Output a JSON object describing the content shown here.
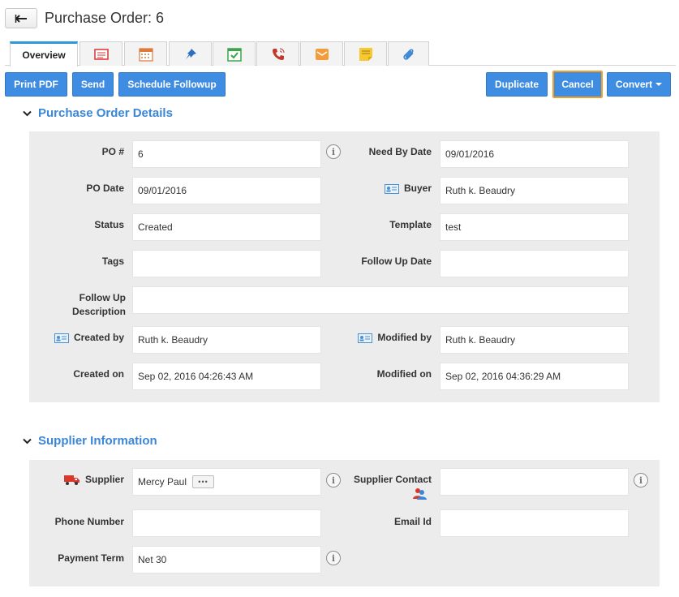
{
  "header": {
    "title": "Purchase Order: 6",
    "back_icon": "back-arrow-icon"
  },
  "tabs": {
    "overview_label": "Overview",
    "icons": [
      "notes-icon",
      "calendar-icon",
      "pin-icon",
      "task-icon",
      "call-icon",
      "email-icon",
      "sticky-note-icon",
      "attachment-icon"
    ]
  },
  "toolbar": {
    "print_pdf": "Print PDF",
    "send": "Send",
    "schedule_followup": "Schedule Followup",
    "duplicate": "Duplicate",
    "cancel": "Cancel",
    "convert": "Convert"
  },
  "po_details": {
    "title": "Purchase Order Details",
    "po_num_label": "PO #",
    "po_num_value": "6",
    "need_by_label": "Need By Date",
    "need_by_value": "09/01/2016",
    "po_date_label": "PO Date",
    "po_date_value": "09/01/2016",
    "buyer_label": "Buyer",
    "buyer_value": "Ruth k. Beaudry",
    "status_label": "Status",
    "status_value": "Created",
    "template_label": "Template",
    "template_value": "test",
    "tags_label": "Tags",
    "tags_value": "",
    "follow_up_date_label": "Follow Up Date",
    "follow_up_date_value": "",
    "follow_up_desc_label_1": "Follow Up",
    "follow_up_desc_label_2": "Description",
    "follow_up_desc_value": "",
    "created_by_label": "Created by",
    "created_by_value": "Ruth k. Beaudry",
    "modified_by_label": "Modified by",
    "modified_by_value": "Ruth k. Beaudry",
    "created_on_label": "Created on",
    "created_on_value": "Sep 02, 2016 04:26:43 AM",
    "modified_on_label": "Modified on",
    "modified_on_value": "Sep 02, 2016 04:36:29 AM"
  },
  "supplier_info": {
    "title": "Supplier Information",
    "supplier_label": "Supplier",
    "supplier_value": "Mercy Paul",
    "supplier_more": "•••",
    "supplier_contact_label": "Supplier Contact",
    "supplier_contact_value": "",
    "phone_label": "Phone Number",
    "phone_value": "",
    "email_label": "Email Id",
    "email_value": "",
    "payment_term_label": "Payment Term",
    "payment_term_value": "Net 30"
  },
  "colors": {
    "primary_button": "#3f8de2",
    "section_title": "#3b86d6",
    "cancel_outline": "#f0a020",
    "active_tab_accent": "#2f98d8",
    "panel_bg": "#ececec"
  }
}
